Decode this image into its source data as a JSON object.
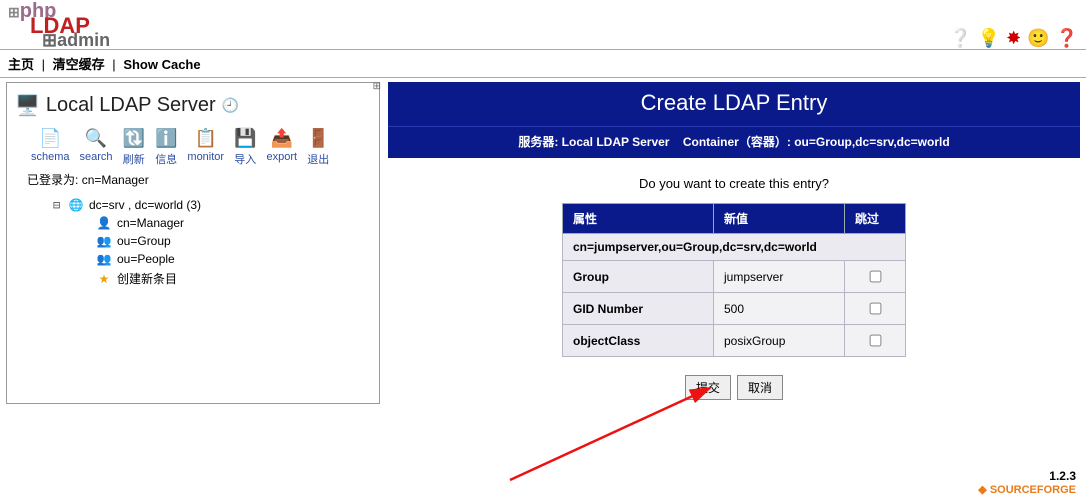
{
  "brand": {
    "l1_prefix": "⊞",
    "l1": "php",
    "l2": "LDAP",
    "l3_prefix": "⊞",
    "l3": "admin"
  },
  "top_nav": {
    "home": "主页",
    "purge": "清空缓存",
    "show_cache": "Show Cache"
  },
  "server": {
    "title": "Local LDAP Server",
    "tools": [
      {
        "id": "schema",
        "label": "schema",
        "glyph": "📄"
      },
      {
        "id": "search",
        "label": "search",
        "glyph": "🔍"
      },
      {
        "id": "refresh",
        "label": "刷新",
        "glyph": "🔃"
      },
      {
        "id": "info",
        "label": "信息",
        "glyph": "ℹ️"
      },
      {
        "id": "monitor",
        "label": "monitor",
        "glyph": "📋"
      },
      {
        "id": "import",
        "label": "导入",
        "glyph": "💾"
      },
      {
        "id": "export",
        "label": "export",
        "glyph": "📤"
      },
      {
        "id": "logout",
        "label": "退出",
        "glyph": "🚪"
      }
    ],
    "logged_in_label": "已登录为:",
    "logged_in_value": "cn=Manager",
    "root": {
      "label": "dc=srv , dc=world (3)"
    },
    "children": [
      {
        "id": "manager",
        "label": "cn=Manager",
        "icon": "👤",
        "cls": "person"
      },
      {
        "id": "group",
        "label": "ou=Group",
        "icon": "👥",
        "cls": "grp"
      },
      {
        "id": "people",
        "label": "ou=People",
        "icon": "👥",
        "cls": "grp"
      },
      {
        "id": "new",
        "label": "创建新条目",
        "icon": "★",
        "cls": "star"
      }
    ]
  },
  "main": {
    "title": "Create LDAP Entry",
    "sub": {
      "server_lbl": "服务器:",
      "server_val": "Local LDAP Server",
      "container_lbl": "Container（容器）:",
      "container_val": "ou=Group,dc=srv,dc=world"
    },
    "question": "Do you want to create this entry?",
    "table": {
      "headers": {
        "attr": "属性",
        "newval": "新值",
        "skip": "跳过"
      },
      "dn": "cn=jumpserver,ou=Group,dc=srv,dc=world",
      "rows": [
        {
          "k": "Group",
          "v": "jumpserver"
        },
        {
          "k": "GID Number",
          "v": "500"
        },
        {
          "k": "objectClass",
          "v": "posixGroup"
        }
      ]
    },
    "buttons": {
      "submit": "提交",
      "cancel": "取消"
    }
  },
  "footer": {
    "version": "1.2.3",
    "sf": "SOURCEFORGE"
  }
}
